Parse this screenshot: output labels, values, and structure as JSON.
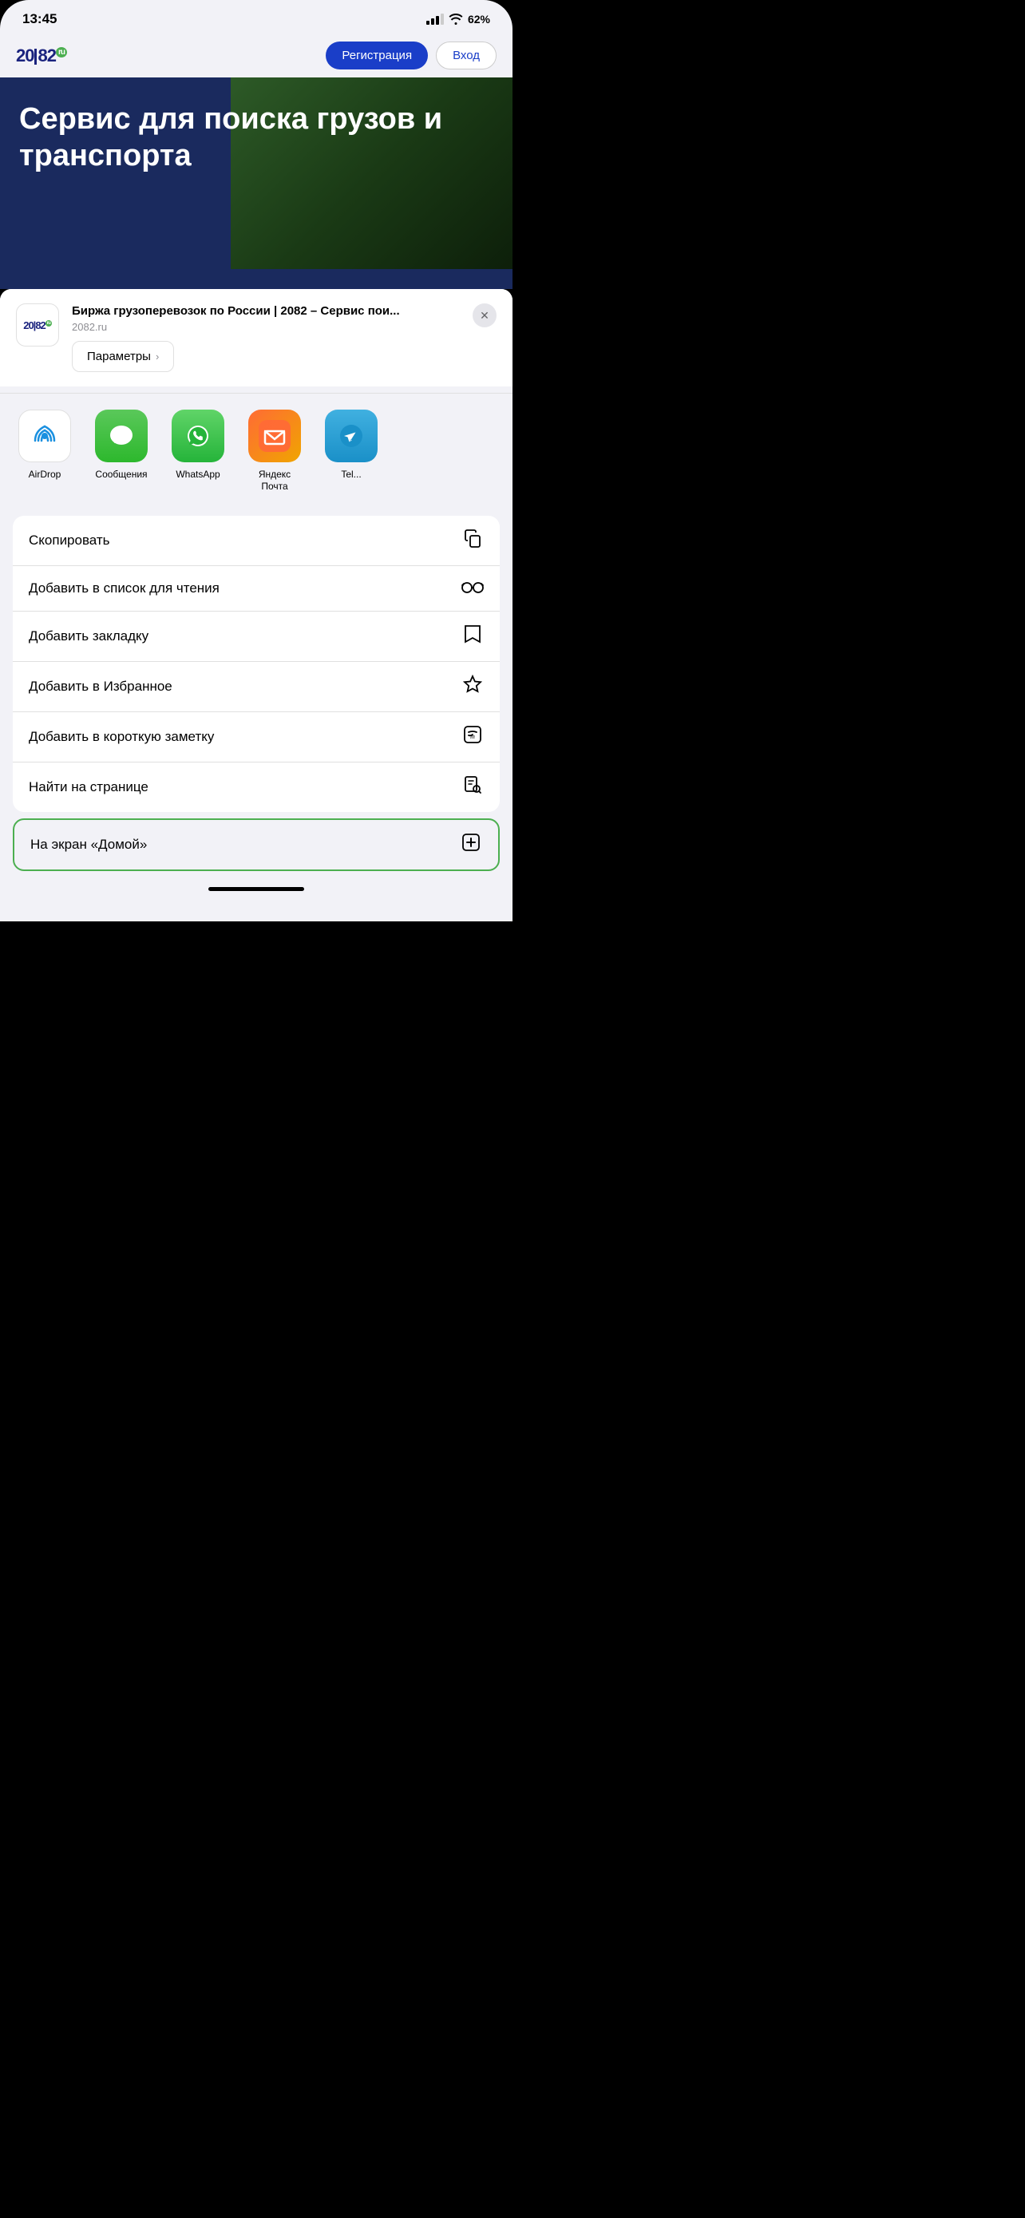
{
  "statusBar": {
    "time": "13:45",
    "batteryLevel": "62"
  },
  "browser": {
    "logo": "20|82",
    "registerBtn": "Регистрация",
    "loginBtn": "Вход",
    "heroText": "Сервис для поиска грузов и транспорта"
  },
  "shareSheet": {
    "siteTitle": "Биржа грузоперевозок по России | 2082 – Сервис пои...",
    "siteUrl": "2082.ru",
    "paramsBtn": "Параметры",
    "closeBtn": "×",
    "apps": [
      {
        "name": "AirDrop",
        "label": "AirDrop",
        "type": "airdrop"
      },
      {
        "name": "Сообщения",
        "label": "Сообщения",
        "type": "messages"
      },
      {
        "name": "WhatsApp",
        "label": "WhatsApp",
        "type": "whatsapp"
      },
      {
        "name": "Яндекс Почта",
        "label": "Яндекс\nПочта",
        "type": "yandex"
      },
      {
        "name": "Telegram",
        "label": "Tel...",
        "type": "telegram"
      }
    ],
    "actions": [
      {
        "label": "Скопировать",
        "icon": "copy",
        "highlighted": false
      },
      {
        "label": "Добавить в список для чтения",
        "icon": "glasses",
        "highlighted": false
      },
      {
        "label": "Добавить закладку",
        "icon": "book",
        "highlighted": false
      },
      {
        "label": "Добавить в Избранное",
        "icon": "star",
        "highlighted": false
      },
      {
        "label": "Добавить в короткую заметку",
        "icon": "note",
        "highlighted": false
      },
      {
        "label": "Найти на странице",
        "icon": "search-doc",
        "highlighted": false
      },
      {
        "label": "На экран «Домой»",
        "icon": "add-square",
        "highlighted": true
      }
    ]
  }
}
